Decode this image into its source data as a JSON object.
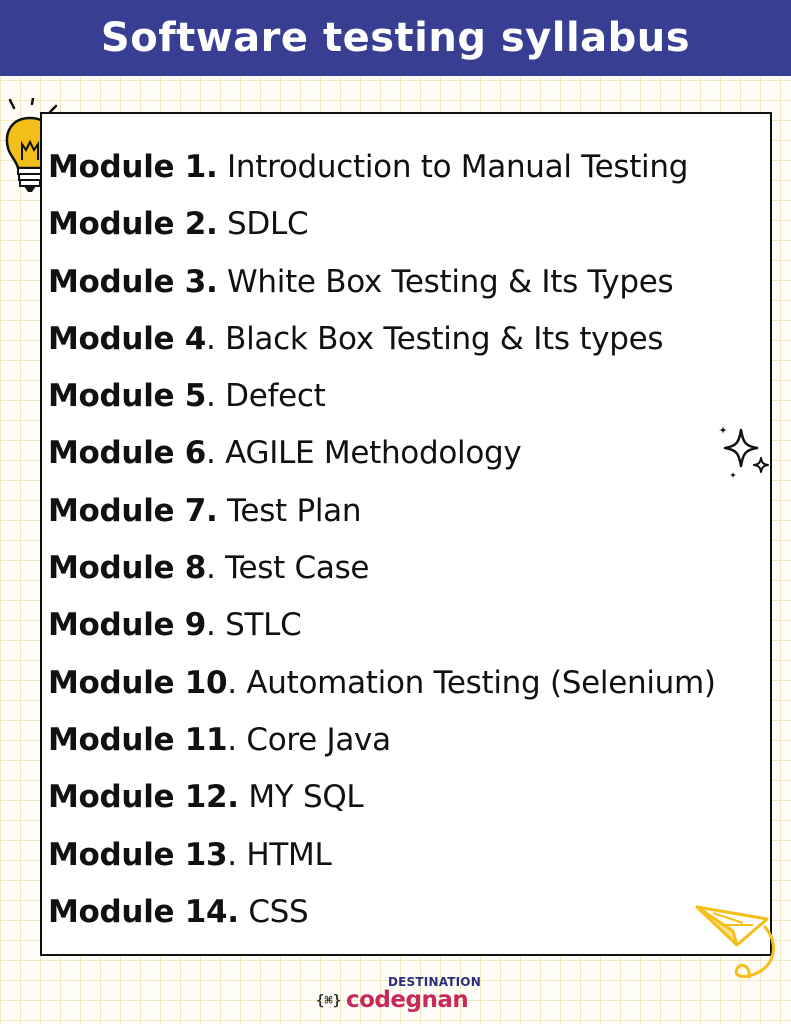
{
  "header": {
    "title": "Software testing syllabus"
  },
  "modules": [
    {
      "label": "Module 1.",
      "title": " Introduction to Manual Testing"
    },
    {
      "label": "Module 2.",
      "title": " SDLC"
    },
    {
      "label": "Module 3.",
      "title": " White Box Testing & Its Types"
    },
    {
      "label": "Module 4",
      "title": ". Black Box Testing & Its types"
    },
    {
      "label": "Module 5",
      "title": ". Defect"
    },
    {
      "label": "Module 6",
      "title": ". AGILE Methodology"
    },
    {
      "label": "Module 7.",
      "title": " Test Plan"
    },
    {
      "label": "Module 8",
      "title": ". Test Case"
    },
    {
      "label": "Module 9",
      "title": ". STLC"
    },
    {
      "label": "Module 10",
      "title": ". Automation Testing (Selenium)"
    },
    {
      "label": "Module 11",
      "title": ". Core Java"
    },
    {
      "label": "Module 12.",
      "title": " MY SQL"
    },
    {
      "label": "Module 13",
      "title": ". HTML"
    },
    {
      "label": "Module 14.",
      "title": " CSS"
    }
  ],
  "logo": {
    "top_text": "DESTINATION",
    "main_text": "codegnan",
    "mark_text": "{⌘}"
  },
  "colors": {
    "header_bg": "#383f93",
    "title_text": "#ffffff",
    "card_border": "#111111",
    "accent_yellow": "#f5bf1b",
    "logo_pink": "#c62a5b",
    "logo_navy": "#2b2f7c"
  },
  "icons": [
    "lightbulb-icon",
    "sparkle-icon",
    "paper-plane-icon"
  ]
}
